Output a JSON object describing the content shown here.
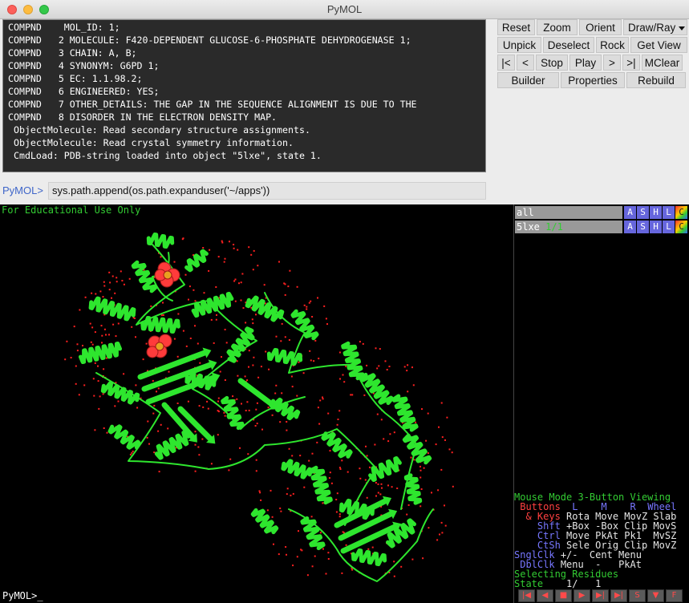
{
  "window": {
    "title": "PyMOL"
  },
  "console": {
    "lines": [
      "COMPND    MOL_ID: 1;",
      "COMPND   2 MOLECULE: F420-DEPENDENT GLUCOSE-6-PHOSPHATE DEHYDROGENASE 1;",
      "COMPND   3 CHAIN: A, B;",
      "COMPND   4 SYNONYM: G6PD 1;",
      "COMPND   5 EC: 1.1.98.2;",
      "COMPND   6 ENGINEERED: YES;",
      "COMPND   7 OTHER_DETAILS: THE GAP IN THE SEQUENCE ALIGNMENT IS DUE TO THE",
      "COMPND   8 DISORDER IN THE ELECTRON DENSITY MAP.",
      " ObjectMolecule: Read secondary structure assignments.",
      " ObjectMolecule: Read crystal symmetry information.",
      " CmdLoad: PDB-string loaded into object \"5lxe\", state 1."
    ]
  },
  "command": {
    "prompt": "PyMOL>",
    "value": "sys.path.append(os.path.expanduser('~/apps'))"
  },
  "buttons": {
    "row1": [
      "Reset",
      "Zoom",
      "Orient",
      "Draw/Ray"
    ],
    "row2": [
      "Unpick",
      "Deselect",
      "Rock",
      "Get View"
    ],
    "row3": [
      "|<",
      "<",
      "Stop",
      "Play",
      ">",
      ">|",
      "MClear"
    ],
    "row4": [
      "Builder",
      "Properties",
      "Rebuild"
    ]
  },
  "viewport": {
    "watermark": "For Educational Use Only",
    "background": "#000000",
    "cartoon_color": "#2ee62e",
    "water_color": "#ff2020",
    "ligand_color": "#ff3b3b"
  },
  "objects": [
    {
      "name": "all",
      "state": ""
    },
    {
      "name": "5lxe",
      "state": "1/1"
    }
  ],
  "object_buttons": [
    "A",
    "S",
    "H",
    "L",
    "C"
  ],
  "mouse_mode": {
    "title": "Mouse Mode 3-Button Viewing",
    "header": {
      "label": "Buttons",
      "L": "L",
      "M": "M",
      "R": "R",
      "wheel": "Wheel"
    },
    "rows": [
      {
        "key": "& Keys",
        "vals": "Rota Move MovZ Slab"
      },
      {
        "key": "Shft",
        "vals": "+Box -Box Clip MovS"
      },
      {
        "key": "Ctrl",
        "vals": "Move PkAt Pk1  MvSZ"
      },
      {
        "key": "CtSh",
        "vals": "Sele Orig Clip MovZ"
      },
      {
        "key": "SnglClk",
        "vals": "+/-  Cent Menu"
      },
      {
        "key": "DblClk",
        "vals": "Menu  -   PkAt"
      }
    ],
    "selecting": "Selecting Residues",
    "state_label": "State",
    "state_value": "1/   1"
  },
  "bottom_prompt": "PyMOL>_",
  "playback_buttons": [
    "|◀",
    "◀",
    "■",
    "▶",
    "▶|",
    "▶|",
    "S",
    "▼",
    "F"
  ]
}
